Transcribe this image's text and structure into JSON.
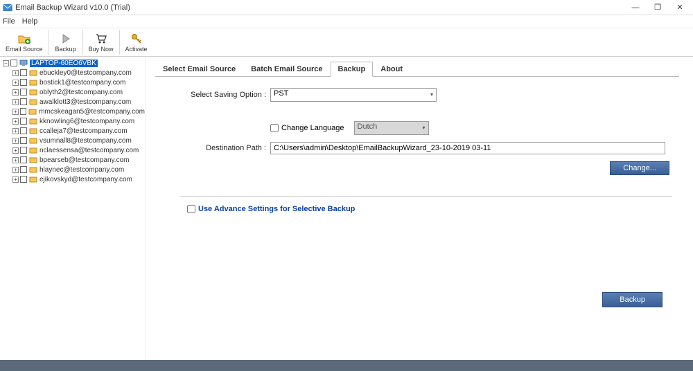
{
  "window": {
    "title": "Email Backup Wizard v10.0 (Trial)",
    "minimize": "—",
    "maximize": "❐",
    "close": "✕"
  },
  "menu": {
    "file": "File",
    "help": "Help"
  },
  "toolbar": {
    "email_source": "Email Source",
    "backup": "Backup",
    "buy_now": "Buy Now",
    "activate": "Activate"
  },
  "tree": {
    "root": "LAPTOP-60EO6VBK",
    "items": [
      "ebuckley0@testcompany.com",
      "bostick1@testcompany.com",
      "oblyth2@testcompany.com",
      "awalklott3@testcompany.com",
      "mmcskeagan5@testcompany.com",
      "kknowling6@testcompany.com",
      "ccalleja7@testcompany.com",
      "vsumnall8@testcompany.com",
      "nclaessensa@testcompany.com",
      "bpearseb@testcompany.com",
      "hlaynec@testcompany.com",
      "ejikovskyd@testcompany.com"
    ]
  },
  "tabs": {
    "select_source": "Select Email Source",
    "batch_source": "Batch Email Source",
    "backup": "Backup",
    "about": "About"
  },
  "panel": {
    "select_saving_label": "Select Saving Option :",
    "saving_option": "PST",
    "change_language_label": "Change Language",
    "language": "Dutch",
    "destination_label": "Destination Path :",
    "destination_value": "C:\\Users\\admin\\Desktop\\EmailBackupWizard_23-10-2019 03-11",
    "change_btn": "Change...",
    "advance_label": "Use Advance Settings for Selective Backup",
    "backup_btn": "Backup"
  }
}
